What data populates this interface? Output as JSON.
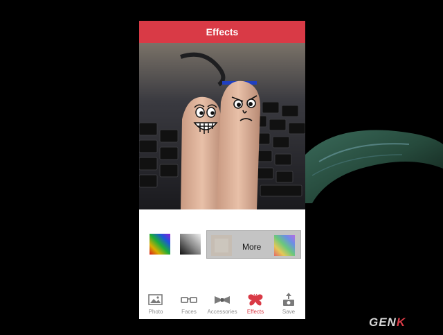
{
  "header": {
    "title": "Effects"
  },
  "effects": {
    "thumbnails": [
      "color-noise-effect",
      "grayscale-noise-effect"
    ],
    "more_group": {
      "label": "More"
    }
  },
  "tabs": [
    {
      "label": "Photo",
      "icon": "photo-icon",
      "active": false
    },
    {
      "label": "Faces",
      "icon": "glasses-icon",
      "active": false
    },
    {
      "label": "Accessories",
      "icon": "bowtie-icon",
      "active": false
    },
    {
      "label": "Effects",
      "icon": "butterfly-icon",
      "active": true
    },
    {
      "label": "Save",
      "icon": "save-upload-icon",
      "active": false
    }
  ],
  "watermark": {
    "text": "GEN",
    "accent_letter": "K"
  },
  "colors": {
    "accent": "#d93a46",
    "tab_inactive": "#8e8e8e",
    "background": "#000000"
  }
}
